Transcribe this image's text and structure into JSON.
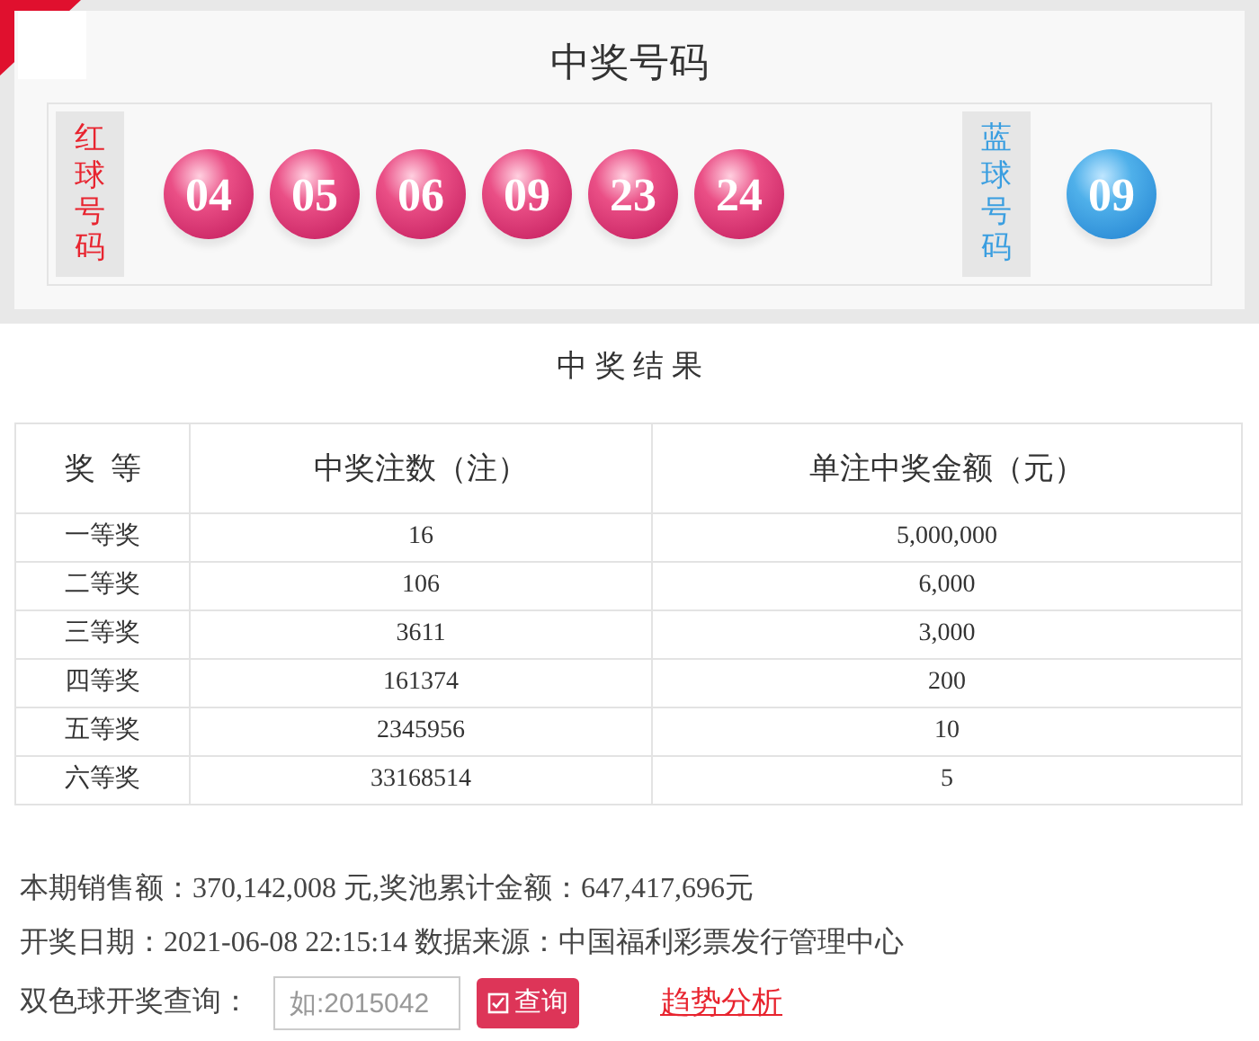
{
  "draw": {
    "title": "中奖号码",
    "red_label": "红球号码",
    "red_balls": [
      "04",
      "05",
      "06",
      "09",
      "23",
      "24"
    ],
    "blue_label": "蓝球号码",
    "blue_balls": [
      "09"
    ]
  },
  "results": {
    "title": "中 奖 结 果",
    "columns": [
      "奖  等",
      "中奖注数（注）",
      "单注中奖金额（元）"
    ],
    "rows": [
      [
        "一等奖",
        "16",
        "5,000,000"
      ],
      [
        "二等奖",
        "106",
        "6,000"
      ],
      [
        "三等奖",
        "3611",
        "3,000"
      ],
      [
        "四等奖",
        "161374",
        "200"
      ],
      [
        "五等奖",
        "2345956",
        "10"
      ],
      [
        "六等奖",
        "33168514",
        "5"
      ]
    ]
  },
  "info": [
    "本期销售额：370,142,008 元,奖池累计金额：647,417,696元",
    "开奖日期：2021-06-08 22:15:14 数据来源：中国福利彩票发行管理中心"
  ],
  "query": {
    "label": "双色球开奖查询：",
    "placeholder": "如:2015042",
    "button": "查询",
    "link": "趋势分析"
  }
}
